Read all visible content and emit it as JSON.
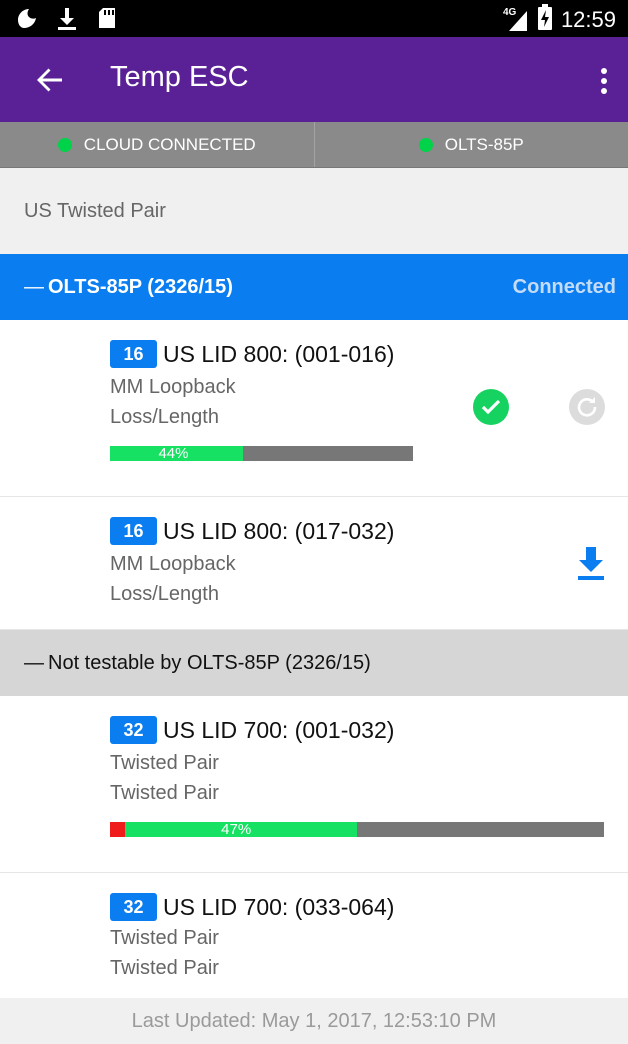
{
  "status_bar": {
    "network": "4G",
    "time": "12:59",
    "icons": [
      "notification-icon",
      "download-icon",
      "sd-card-icon",
      "signal-icon",
      "battery-charging-icon"
    ]
  },
  "app_bar": {
    "title": "Temp ESC"
  },
  "connection_bar": {
    "cloud_label": "CLOUD CONNECTED",
    "device_label": "OLTS-85P",
    "status_color": "#00d34a"
  },
  "section": {
    "label": "US Twisted Pair"
  },
  "group": {
    "collapse_symbol": "—",
    "name": "OLTS-85P (2326/15)",
    "status": "Connected",
    "color": "#0a7df0"
  },
  "items": [
    {
      "badge": "16",
      "name": "US LID 800: (001-016)",
      "line1": "MM Loopback",
      "line2": "Loss/Length",
      "progress_label": "44%",
      "progress": 0.44
    },
    {
      "badge": "16",
      "name": "US LID 800: (017-032)",
      "line1": "MM Loopback",
      "line2": "Loss/Length"
    }
  ],
  "subgroup": {
    "collapse_symbol": "—",
    "label": "Not testable by OLTS-85P (2326/15)"
  },
  "untestable_items": [
    {
      "badge": "32",
      "name": "US LID 700: (001-032)",
      "line1": "Twisted Pair",
      "line2": "Twisted Pair",
      "progress_label": "47%",
      "progress": 0.47,
      "error_fraction": 0.03
    },
    {
      "badge": "32",
      "name": "US LID 700: (033-064)",
      "line1": "Twisted Pair",
      "line2": "Twisted Pair"
    }
  ],
  "footer": {
    "text": "Last Updated: May 1, 2017, 12:53:10 PM"
  }
}
